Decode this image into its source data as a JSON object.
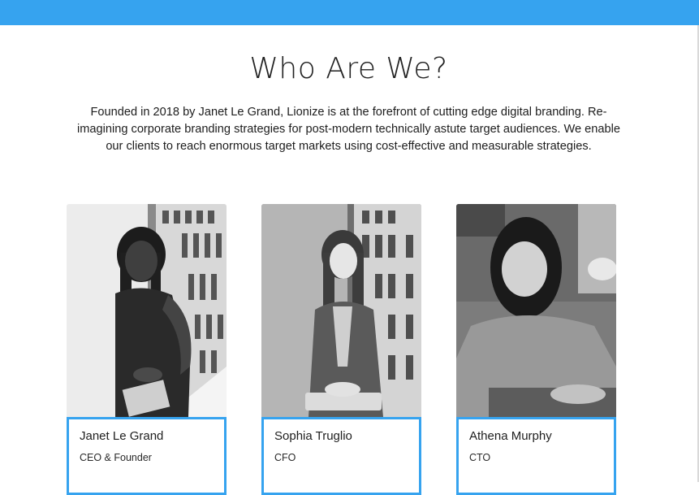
{
  "header": {
    "accent_color": "#36a3ef"
  },
  "about": {
    "title": "Who Are We?",
    "intro": "Founded in 2018 by Janet Le Grand, Lionize is at the forefront of cutting edge digital branding. Re-imagining corporate branding strategies for post-modern technically astute target audiences. We enable our clients to reach enormous target markets using cost-effective and measurable strategies."
  },
  "team": [
    {
      "name": "Janet Le Grand",
      "role": "CEO & Founder",
      "photo": "portrait-janet-le-grand"
    },
    {
      "name": "Sophia Truglio",
      "role": "CFO",
      "photo": "portrait-sophia-truglio"
    },
    {
      "name": "Athena Murphy",
      "role": "CTO",
      "photo": "portrait-athena-murphy"
    }
  ]
}
